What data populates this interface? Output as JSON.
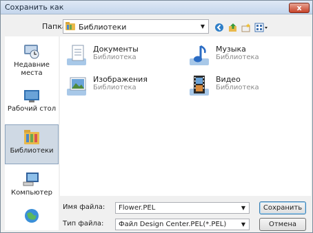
{
  "window": {
    "title": "Сохранить как",
    "close_label": "x"
  },
  "toolbar": {
    "folder_label": "Папка:",
    "folder_value": "Библиотеки"
  },
  "places": [
    {
      "label": "Недавние места"
    },
    {
      "label": "Рабочий стол"
    },
    {
      "label": "Библиотеки"
    },
    {
      "label": "Компьютер"
    }
  ],
  "libraries": [
    {
      "name": "Документы",
      "sub": "Библиотека"
    },
    {
      "name": "Музыка",
      "sub": "Библиотека"
    },
    {
      "name": "Изображения",
      "sub": "Библиотека"
    },
    {
      "name": "Видео",
      "sub": "Библиотека"
    }
  ],
  "form": {
    "filename_label": "Имя файла:",
    "filename_value": "Flower.PEL",
    "filetype_label": "Тип файла:",
    "filetype_value": "Файл Design Center.PEL(*.PEL)",
    "save_label": "Сохранить",
    "cancel_label": "Отмена"
  }
}
